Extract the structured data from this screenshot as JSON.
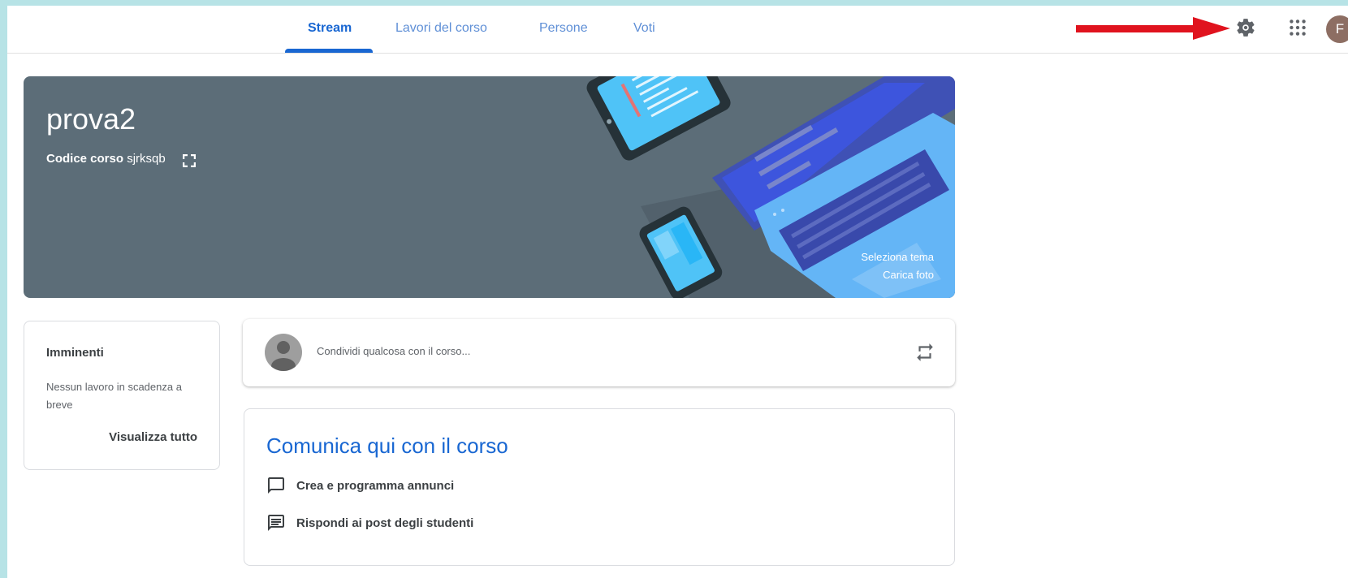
{
  "tabs": [
    {
      "label": "Stream",
      "active": true
    },
    {
      "label": "Lavori del corso",
      "active": false
    },
    {
      "label": "Persone",
      "active": false
    },
    {
      "label": "Voti",
      "active": false
    }
  ],
  "header": {
    "avatar_initial": "F",
    "icons": [
      "settings-gear-icon",
      "apps-grid-icon"
    ],
    "annotation_arrow_color": "#e0131e"
  },
  "banner": {
    "title": "prova2",
    "code_label": "Codice corso",
    "code_value": "sjrksqb",
    "select_theme": "Seleziona tema",
    "upload_photo": "Carica foto",
    "bg_color": "#5c6d78"
  },
  "upcoming": {
    "title": "Imminenti",
    "text": "Nessun lavoro in scadenza a breve",
    "link": "Visualizza tutto"
  },
  "share": {
    "placeholder": "Condividi qualcosa con il corso..."
  },
  "info": {
    "title": "Comunica qui con il corso",
    "items": [
      "Crea e programma annunci",
      "Rispondi ai post degli studenti"
    ]
  },
  "accent_color": "#1967d2"
}
